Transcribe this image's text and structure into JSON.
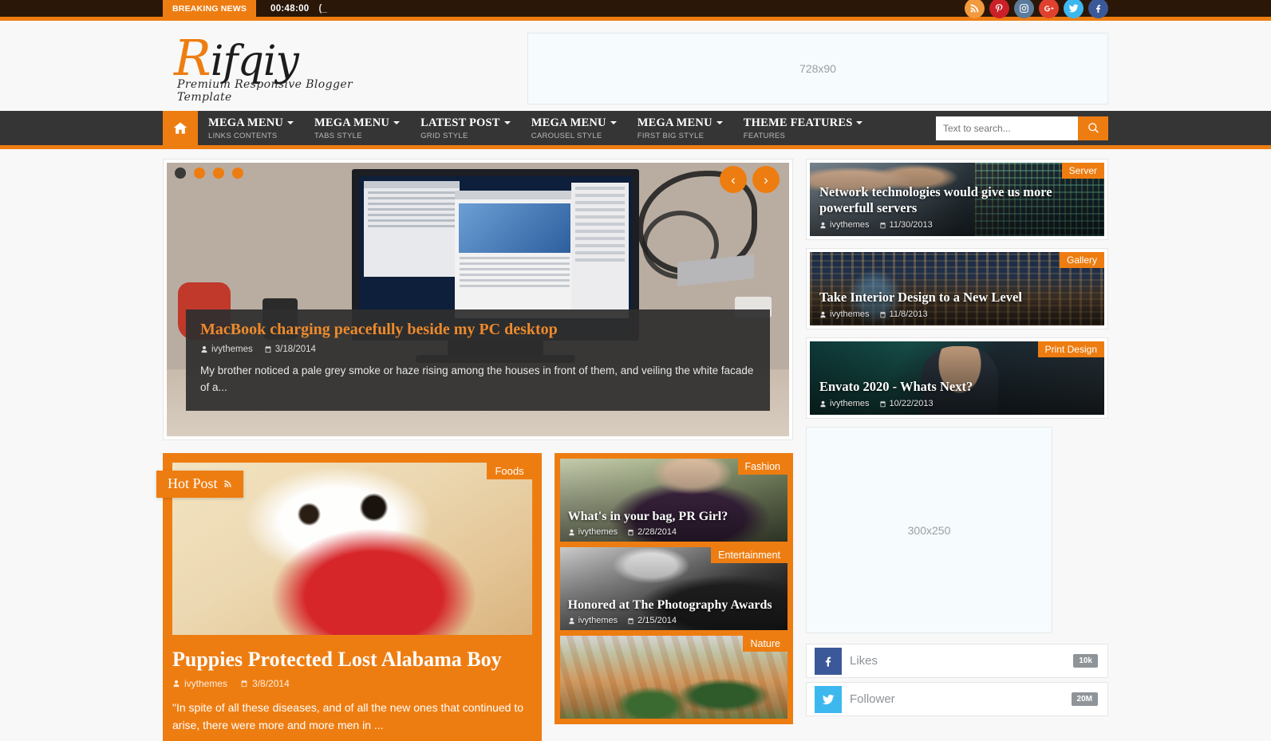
{
  "colors": {
    "accent": "#ee7d11",
    "topbar_bg": "#2b1708",
    "nav_bg": "#353535",
    "page_bg": "#f8f8f8"
  },
  "topbar": {
    "breaking_label": "BREAKING NEWS",
    "ticker_time": "00:48:00",
    "ticker_extra": "(_",
    "social": [
      {
        "name": "rss-icon",
        "label": "RSS",
        "color": "#f29a3e"
      },
      {
        "name": "pinterest-icon",
        "label": "Pinterest",
        "color": "#cb2027"
      },
      {
        "name": "instagram-icon",
        "label": "Instagram",
        "color": "#5c7b9c"
      },
      {
        "name": "googleplus-icon",
        "label": "Google Plus",
        "color": "#e0412e"
      },
      {
        "name": "twitter-icon",
        "label": "Twitter",
        "color": "#3db8ef"
      },
      {
        "name": "facebook-icon",
        "label": "Facebook",
        "color": "#3b5998"
      }
    ]
  },
  "header": {
    "logo_cap": "R",
    "logo_rest": "ifqiy",
    "logo_tagline": "Premium Responsive Blogger Template",
    "ad_banner_label": "728x90"
  },
  "nav": {
    "home_icon": "home-icon",
    "items": [
      {
        "title": "MEGA MENU",
        "sub": "LINKS CONTENTS"
      },
      {
        "title": "MEGA MENU",
        "sub": "TABS STYLE"
      },
      {
        "title": "LATEST POST",
        "sub": "GRID STYLE"
      },
      {
        "title": "MEGA MENU",
        "sub": "CAROUSEL STYLE"
      },
      {
        "title": "MEGA MENU",
        "sub": "FIRST BIG STYLE"
      },
      {
        "title": "THEME FEATURES",
        "sub": "FEATURES"
      }
    ],
    "search_placeholder": "Text to search...",
    "search_value": ""
  },
  "slider": {
    "dots": 4,
    "active_dot": 0,
    "prev_label": "‹",
    "next_label": "›",
    "title": "MacBook charging peacefully beside my PC desktop",
    "author": "ivythemes",
    "date": "3/18/2014",
    "excerpt": "My brother noticed a pale grey smoke or haze rising among the houses in front of them, and veiling the white facade of a..."
  },
  "featured": [
    {
      "category": "Server",
      "title": "Network technologies would give us more powerfull servers",
      "author": "ivythemes",
      "date": "11/30/2013",
      "photo": "ph-server"
    },
    {
      "category": "Gallery",
      "title": "Take Interior Design to a New Level",
      "author": "ivythemes",
      "date": "11/8/2013",
      "photo": "ph-city"
    },
    {
      "category": "Print Design",
      "title": "Envato 2020 - Whats Next?",
      "author": "ivythemes",
      "date": "10/22/2013",
      "photo": "ph-man"
    }
  ],
  "hotpost": {
    "badge": "Hot Post",
    "badge_icon": "rss-icon",
    "category": "Foods",
    "title": "Puppies Protected Lost Alabama Boy",
    "author": "ivythemes",
    "date": "3/8/2014",
    "excerpt": "\"In spite of all these diseases, and of all the new ones that continued to arise, there were more and more men in ..."
  },
  "midposts": [
    {
      "category": "Fashion",
      "title": "What's in your bag, PR Girl?",
      "author": "ivythemes",
      "date": "2/28/2014",
      "photo": "ph-fashion"
    },
    {
      "category": "Entertainment",
      "title": "Honored at The Photography Awards",
      "author": "ivythemes",
      "date": "2/15/2014",
      "photo": "ph-music"
    },
    {
      "category": "Nature",
      "title": "",
      "author": "",
      "date": "",
      "photo": "ph-nature"
    }
  ],
  "sidebar_lower": {
    "ad_label": "300x250",
    "counters": [
      {
        "icon": "facebook-icon",
        "label": "Likes",
        "count": "10k",
        "color": "#3b5998"
      },
      {
        "icon": "twitter-icon",
        "label": "Follower",
        "count": "20M",
        "color": "#3db8ef"
      }
    ]
  }
}
